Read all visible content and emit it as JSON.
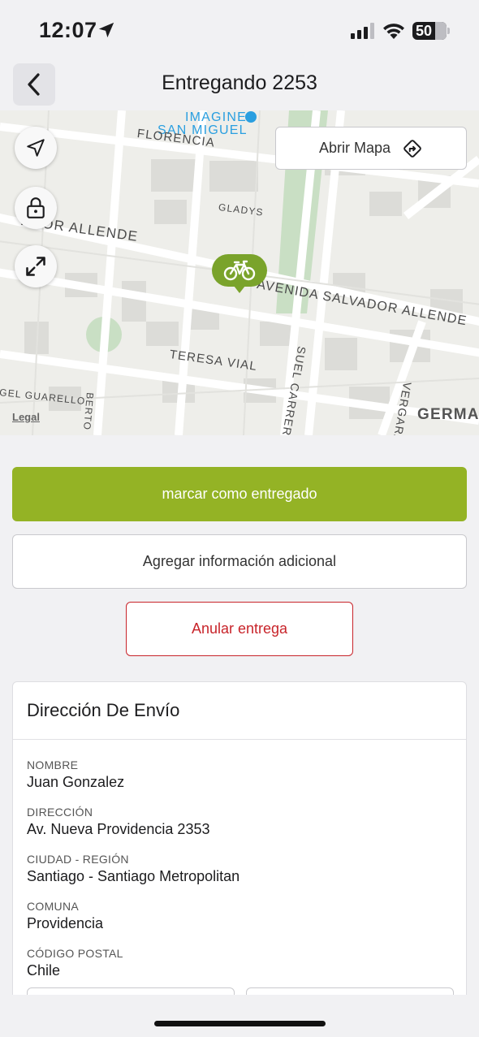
{
  "status": {
    "time": "12:07",
    "battery": "50"
  },
  "nav": {
    "title": "Entregando 2253",
    "back_icon": "chevron-left-icon"
  },
  "map": {
    "open_map_label": "Abrir Mapa",
    "legal_label": "Legal",
    "street_labels": {
      "imagine": "IMAGINE -",
      "san_miguel": "SAN MIGUEL",
      "florencia": "FLORENCIA",
      "gladys": "GLADYS",
      "allende_left": "ADOR ALLENDE",
      "avenida": "AVENIDA SALVADOR ALLENDE",
      "teresa": "TERESA VIAL",
      "guarello": "GEL GUARELLO",
      "carrera": "SUEL CARRERA",
      "vergara": "VERGARA",
      "german": "GERMAN",
      "oberto": "BERTO"
    },
    "controls": [
      "navigation-arrow-icon",
      "lock-icon",
      "expand-icon"
    ],
    "colors": {
      "pin": "#7aa32b",
      "park": "#c9dfc4",
      "road": "#ffffff",
      "block": "#dcdcd8"
    }
  },
  "actions": {
    "mark_delivered": "marcar como entregado",
    "add_info": "Agregar información adicional",
    "cancel": "Anular entrega"
  },
  "shipping": {
    "title": "Dirección De Envío",
    "fields": [
      {
        "label": "NOMBRE",
        "value": "Juan Gonzalez"
      },
      {
        "label": "DIRECCIÓN",
        "value": "Av. Nueva Providencia 2353"
      },
      {
        "label": "CIUDAD - REGIÓN",
        "value": "Santiago - Santiago Metropolitan"
      },
      {
        "label": "COMUNA",
        "value": "Providencia"
      },
      {
        "label": "CÓDIGO POSTAL",
        "value": "Chile"
      }
    ]
  },
  "colors": {
    "primary": "#94b325",
    "danger": "#c8242a"
  }
}
